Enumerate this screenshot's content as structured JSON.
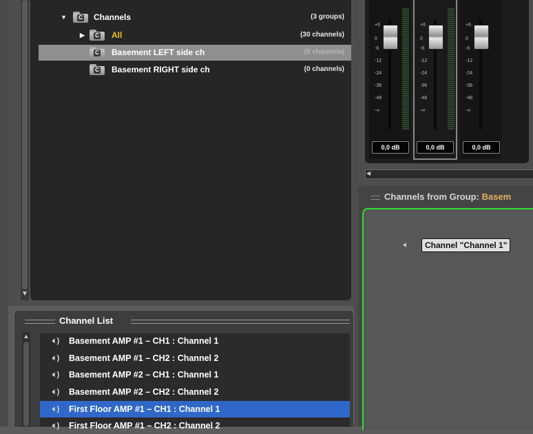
{
  "tree": {
    "root": {
      "label": "Channels",
      "count": "(3 groups)"
    },
    "items": [
      {
        "label": "All",
        "count": "(30 channels)"
      },
      {
        "label": "Basement LEFT side ch",
        "count": "(0 channels)"
      },
      {
        "label": "Basement RIGHT side ch",
        "count": "(0 channels)"
      }
    ]
  },
  "mixer": {
    "scale": [
      "+6",
      "0",
      "-6",
      "-12",
      "-24",
      "-36",
      "-48",
      "-∞"
    ],
    "strips": [
      {
        "db": "0,0 dB"
      },
      {
        "db": "0,0 dB"
      },
      {
        "db": "0,0 dB"
      }
    ]
  },
  "group_panel": {
    "title_prefix": "Channels from Group:",
    "group_name": "Basem",
    "channel_chip": "Channel \"Channel 1\""
  },
  "channel_list": {
    "title": "Channel List",
    "rows": [
      "Basement AMP #1 – CH1 : Channel 1",
      "Basement AMP #1 – CH2 : Channel 2",
      "Basement AMP #2 – CH1 : Channel 1",
      "Basement AMP #2 – CH2 : Channel 2",
      "First Floor AMP #1 – CH1 : Channel 1",
      "First Floor AMP #1 – CH2 : Channel 2"
    ]
  }
}
